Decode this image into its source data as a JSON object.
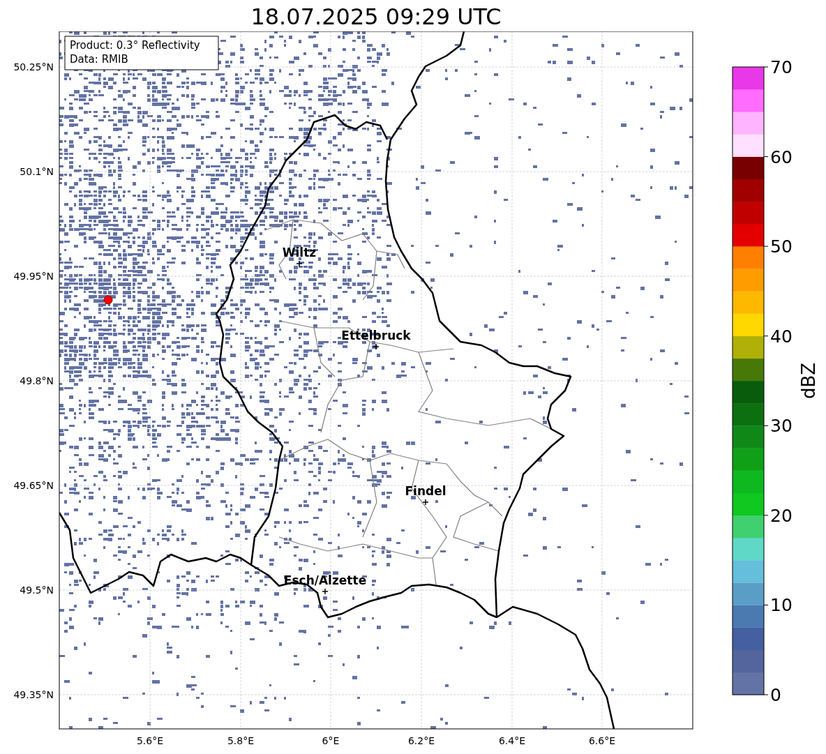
{
  "title": "18.07.2025 09:29 UTC",
  "info_box": {
    "lines": [
      "Product: 0.3° Reflectivity",
      "Data: RMIB"
    ]
  },
  "map": {
    "yticks": [
      "50.25°N",
      "50.1°N",
      "49.95°N",
      "49.8°N",
      "49.65°N",
      "49.5°N",
      "49.35°N"
    ],
    "xticks": [
      "5.6°E",
      "5.8°E",
      "6°E",
      "6.2°E",
      "6.4°E",
      "6.6°E"
    ],
    "cities": [
      {
        "name": "Wiltz"
      },
      {
        "name": "Ettelbruck"
      },
      {
        "name": "Findel"
      },
      {
        "name": "Esch/Alzette"
      }
    ]
  },
  "colorbar": {
    "label": "dBZ",
    "ticks": [
      "70",
      "60",
      "50",
      "40",
      "30",
      "20",
      "10",
      "0"
    ],
    "segments": [
      {
        "color": "#6473a5"
      },
      {
        "color": "#53659c"
      },
      {
        "color": "#4460a0"
      },
      {
        "color": "#4a7ab0"
      },
      {
        "color": "#5a9ec8"
      },
      {
        "color": "#64bedc"
      },
      {
        "color": "#60d8c8"
      },
      {
        "color": "#40d070"
      },
      {
        "color": "#10c820"
      },
      {
        "color": "#10b820"
      },
      {
        "color": "#10a018"
      },
      {
        "color": "#108818"
      },
      {
        "color": "#0c7010"
      },
      {
        "color": "#085c0c"
      },
      {
        "color": "#487808"
      },
      {
        "color": "#b0b008"
      },
      {
        "color": "#ffd800"
      },
      {
        "color": "#ffb800"
      },
      {
        "color": "#ff9c00"
      },
      {
        "color": "#ff8000"
      },
      {
        "color": "#e40000"
      },
      {
        "color": "#c00000"
      },
      {
        "color": "#a00000"
      },
      {
        "color": "#780000"
      },
      {
        "color": "#ffe0ff"
      },
      {
        "color": "#ffb4ff"
      },
      {
        "color": "#ff6cff"
      },
      {
        "color": "#e838e8"
      }
    ]
  }
}
